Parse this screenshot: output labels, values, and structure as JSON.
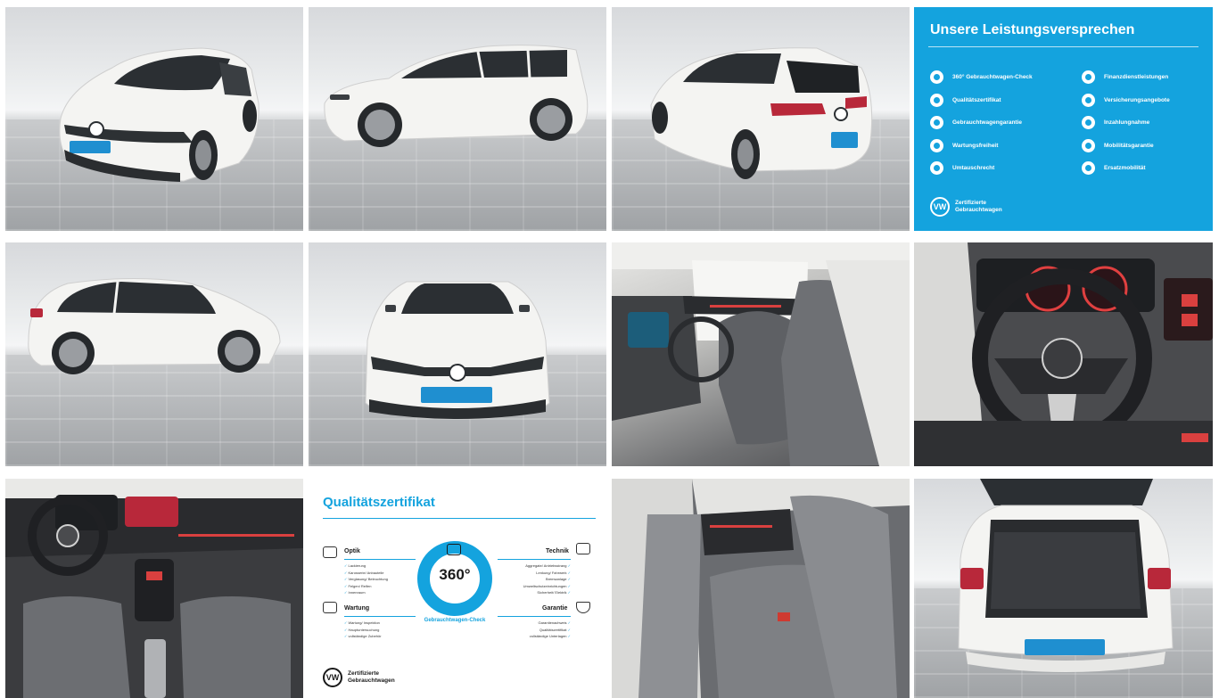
{
  "colors": {
    "vw_blue": "#14a3de",
    "car_white": "#f4f4f2",
    "plate_blue": "#1f8fd0"
  },
  "gallery": {
    "tiles": [
      {
        "kind": "photo",
        "view": "front-left exterior"
      },
      {
        "kind": "photo",
        "view": "side-right exterior"
      },
      {
        "kind": "photo",
        "view": "rear-left exterior"
      },
      {
        "kind": "info",
        "view": "leistungsversprechen"
      },
      {
        "kind": "photo",
        "view": "side-left exterior"
      },
      {
        "kind": "photo",
        "view": "front exterior"
      },
      {
        "kind": "photo",
        "view": "front seats interior"
      },
      {
        "kind": "photo",
        "view": "steering wheel cockpit"
      },
      {
        "kind": "photo",
        "view": "dashboard interior"
      },
      {
        "kind": "info",
        "view": "qualitaetszertifikat"
      },
      {
        "kind": "photo",
        "view": "rear seats interior"
      },
      {
        "kind": "photo",
        "view": "trunk open"
      }
    ]
  },
  "plate": {
    "text": "Zertifizierte Gebrauchtwagen"
  },
  "promise": {
    "title": "Unsere Leistungsversprechen",
    "left_items": [
      "360° Gebrauchtwagen-Check",
      "Qualitätszertifikat",
      "Gebrauchtwagengarantie",
      "Wartungsfreiheit",
      "Umtauschrecht"
    ],
    "right_items": [
      "Finanzdienstleistungen",
      "Versicherungsangebote",
      "Inzahlungnahme",
      "Mobilitätsgarantie",
      "Ersatzmobilität"
    ],
    "brand_line1": "Zertifizierte",
    "brand_line2": "Gebrauchtwagen",
    "logo": "VW"
  },
  "quality": {
    "title": "Qualitätszertifikat",
    "center_value": "360°",
    "center_label": "Gebrauchtwagen-Check",
    "optik": {
      "label": "Optik",
      "items": [
        "Lackierung",
        "Karosserie/ Anbauteile",
        "Verglasung/ Beleuchtung",
        "Felgen/ Reifen",
        "Innenraum"
      ]
    },
    "technik": {
      "label": "Technik",
      "items": [
        "Aggregate/ Antriebsstrang",
        "Lenkung/ Fahrwerk",
        "Bremsanlage",
        "Umweltschutzeinrichtungen",
        "Sicherheit/ Elektrik"
      ]
    },
    "wartung": {
      "label": "Wartung",
      "items": [
        "Wartung/ Inspektion",
        "Hauptuntersuchung",
        "vollständige Zubehör"
      ]
    },
    "garantie": {
      "label": "Garantie",
      "items": [
        "Garantienachweis",
        "Qualitätszertifikat",
        "vollständige Unterlagen"
      ]
    },
    "brand_line1": "Zertifizierte",
    "brand_line2": "Gebrauchtwagen",
    "logo": "VW"
  }
}
